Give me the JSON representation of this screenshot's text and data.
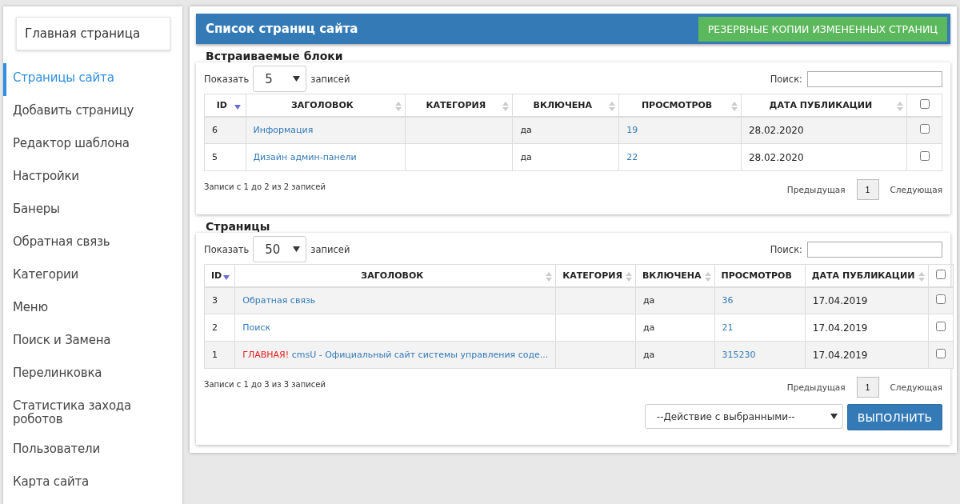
{
  "sidebar": {
    "home_button": "Главная страница",
    "items": [
      {
        "label": "Страницы сайта",
        "selected": true
      },
      {
        "label": "Добавить страницу",
        "selected": false
      },
      {
        "label": "Редактор шаблона",
        "selected": false
      },
      {
        "label": "Настройки",
        "selected": false
      },
      {
        "label": "Банеры",
        "selected": false
      },
      {
        "label": "Обратная связь",
        "selected": false
      },
      {
        "label": "Категории",
        "selected": false
      },
      {
        "label": "Меню",
        "selected": false
      },
      {
        "label": "Поиск и Замена",
        "selected": false
      },
      {
        "label": "Перелинковка",
        "selected": false
      },
      {
        "label": "Статистика захода роботов",
        "selected": false
      },
      {
        "label": "Пользователи",
        "selected": false
      },
      {
        "label": "Карта сайта",
        "selected": false
      }
    ]
  },
  "header": {
    "title": "Список страниц сайта",
    "button": "РЕЗЕРВНЫЕ КОПИИ ИЗМЕНЕННЫХ СТРАНИЦ"
  },
  "sections": [
    {
      "title": "Встраиваемые блоки",
      "show_label": "Показать",
      "page_size": "5",
      "records_label": "записей",
      "search_label": "Поиск:",
      "columns": [
        {
          "label": "ID",
          "sorted": true
        },
        {
          "label": "ЗАГОЛОВОК",
          "sortable": true,
          "sorted": false
        },
        {
          "label": "КАТЕГОРИЯ",
          "sortable": true,
          "sorted": false
        },
        {
          "label": "ВКЛЮЧЕНА",
          "sortable": true,
          "sorted": false
        },
        {
          "label": "ПРОСМОТРОВ",
          "sortable": true,
          "sorted": false
        },
        {
          "label": "ДАТА ПУБЛИКАЦИИ",
          "sortable": true,
          "sorted": false
        }
      ],
      "select_all_checked": false,
      "rows": [
        {
          "id": "6",
          "title": "Информация",
          "enabled": "да",
          "views": "19",
          "date": "28.02.2020",
          "checked": false
        },
        {
          "id": "5",
          "title": "Дизайн админ-панели",
          "enabled": "да",
          "views": "22",
          "date": "28.02.2020",
          "checked": false
        }
      ],
      "info": "Записи с 1 до 2 из 2 записей",
      "prev": "Предыдущая",
      "page": "1",
      "next": "Следующая"
    },
    {
      "title": "Страницы",
      "show_label": "Показать",
      "page_size": "50",
      "records_label": "записей",
      "search_label": "Поиск:",
      "columns": [
        {
          "label": "ID",
          "sorted": true
        },
        {
          "label": "ЗАГОЛОВОК",
          "sortable": true,
          "sorted": false
        },
        {
          "label": "КАТЕГОРИЯ",
          "sortable": true,
          "sorted": false
        },
        {
          "label": "ВКЛЮЧЕНА",
          "sortable": true,
          "sorted": false
        },
        {
          "label": "ПРОСМОТРОВ",
          "sortable": false,
          "sorted": false
        },
        {
          "label": "ДАТА ПУБЛИКАЦИИ",
          "sortable": true,
          "sorted": false
        }
      ],
      "select_all_checked": false,
      "rows": [
        {
          "id": "3",
          "title": "Обратная связь",
          "enabled": "да",
          "views": "36",
          "date": "17.04.2019",
          "checked": false
        },
        {
          "id": "2",
          "title": "Поиск",
          "enabled": "да",
          "views": "21",
          "date": "17.04.2019",
          "checked": false
        },
        {
          "id": "1",
          "badge": "ГЛАВНАЯ!",
          "title": "cmsU - Официальный сайт системы управления соде...",
          "enabled": "да",
          "views": "315230",
          "date": "17.04.2019",
          "checked": false
        }
      ],
      "info": "Записи с 1 до 3 из 3 записей",
      "prev": "Предыдущая",
      "page": "1",
      "next": "Следующая",
      "bulk_action": {
        "placeholder": "--Действие с выбранными--",
        "button": "ВЫПОЛНИТЬ"
      }
    }
  ]
}
